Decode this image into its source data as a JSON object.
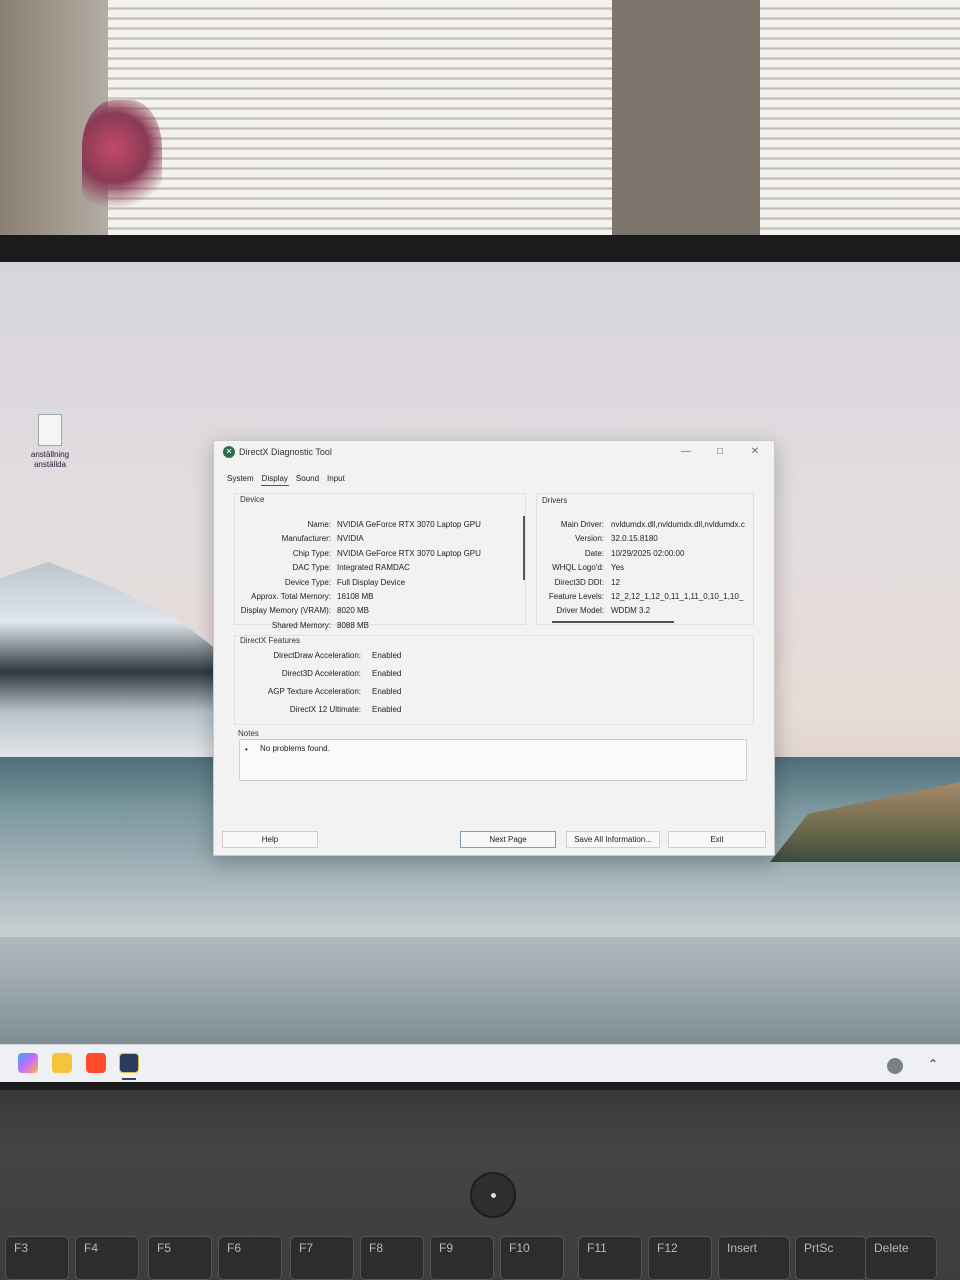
{
  "desktop": {
    "icon_label": "anställning anställda"
  },
  "window": {
    "title": "DirectX Diagnostic Tool",
    "controls": {
      "minimize": "—",
      "maximize": "□",
      "close": "✕"
    },
    "tabs": [
      "System",
      "Display",
      "Sound",
      "Input"
    ],
    "active_tab": "Display",
    "device": {
      "section_title": "Device",
      "rows": [
        {
          "label": "Name:",
          "value": "NVIDIA GeForce RTX 3070 Laptop GPU"
        },
        {
          "label": "Manufacturer:",
          "value": "NVIDIA"
        },
        {
          "label": "Chip Type:",
          "value": "NVIDIA GeForce RTX 3070 Laptop GPU"
        },
        {
          "label": "DAC Type:",
          "value": "Integrated RAMDAC"
        },
        {
          "label": "Device Type:",
          "value": "Full Display Device"
        },
        {
          "label": "Approx. Total Memory:",
          "value": "16108 MB"
        },
        {
          "label": "Display Memory (VRAM):",
          "value": "8020 MB"
        },
        {
          "label": "Shared Memory:",
          "value": "8088 MB"
        }
      ]
    },
    "drivers": {
      "section_title": "Drivers",
      "rows": [
        {
          "label": "Main Driver:",
          "value": "nvldumdx.dll,nvldumdx.dll,nvldumdx.c"
        },
        {
          "label": "Version:",
          "value": "32.0.15.8180"
        },
        {
          "label": "Date:",
          "value": "10/29/2025 02:00:00"
        },
        {
          "label": "WHQL Logo'd:",
          "value": "Yes"
        },
        {
          "label": "Direct3D DDI:",
          "value": "12"
        },
        {
          "label": "Feature Levels:",
          "value": "12_2,12_1,12_0,11_1,11_0,10_1,10_"
        },
        {
          "label": "Driver Model:",
          "value": "WDDM 3.2"
        }
      ]
    },
    "features": {
      "section_title": "DirectX Features",
      "rows": [
        {
          "label": "DirectDraw Acceleration:",
          "value": "Enabled"
        },
        {
          "label": "Direct3D Acceleration:",
          "value": "Enabled"
        },
        {
          "label": "AGP Texture Acceleration:",
          "value": "Enabled"
        },
        {
          "label": "DirectX 12 Ultimate:",
          "value": "Enabled"
        }
      ]
    },
    "notes": {
      "section_title": "Notes",
      "bullet": "•",
      "text": "No problems found."
    },
    "buttons": {
      "help": "Help",
      "next_page": "Next Page",
      "save_all": "Save All Information...",
      "exit": "Exit"
    }
  },
  "keyboard": [
    "F3",
    "F4",
    "F5",
    "F6",
    "F7",
    "F8",
    "F9",
    "F10",
    "F11",
    "F12",
    "Insert",
    "PrtSc",
    "Delete"
  ],
  "colors": {
    "window_bg": "#f2f2f2",
    "accent_button": "#7a9cc6",
    "taskbar": "#eef0f3"
  }
}
